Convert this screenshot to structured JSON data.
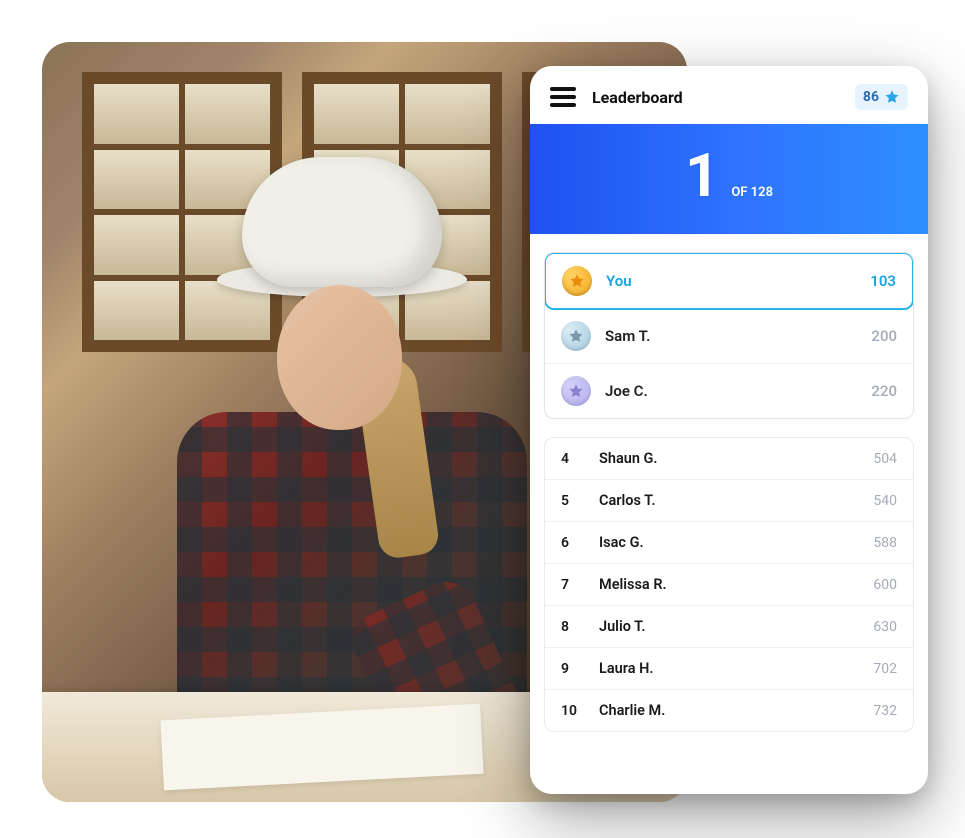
{
  "header": {
    "title": "Leaderboard",
    "points": "86"
  },
  "rank": {
    "position": "1",
    "of_label": "OF 128"
  },
  "top_players": [
    {
      "name": "You",
      "score": "103",
      "medal": "gold",
      "highlight": true
    },
    {
      "name": "Sam T.",
      "score": "200",
      "medal": "silver",
      "highlight": false
    },
    {
      "name": "Joe C.",
      "score": "220",
      "medal": "bronze",
      "highlight": false
    }
  ],
  "players": [
    {
      "rank": "4",
      "name": "Shaun G.",
      "score": "504"
    },
    {
      "rank": "5",
      "name": "Carlos T.",
      "score": "540"
    },
    {
      "rank": "6",
      "name": "Isac G.",
      "score": "588"
    },
    {
      "rank": "7",
      "name": "Melissa R.",
      "score": "600"
    },
    {
      "rank": "8",
      "name": "Julio T.",
      "score": "630"
    },
    {
      "rank": "9",
      "name": "Laura H.",
      "score": "702"
    },
    {
      "rank": "10",
      "name": "Charlie M.",
      "score": "732"
    }
  ]
}
